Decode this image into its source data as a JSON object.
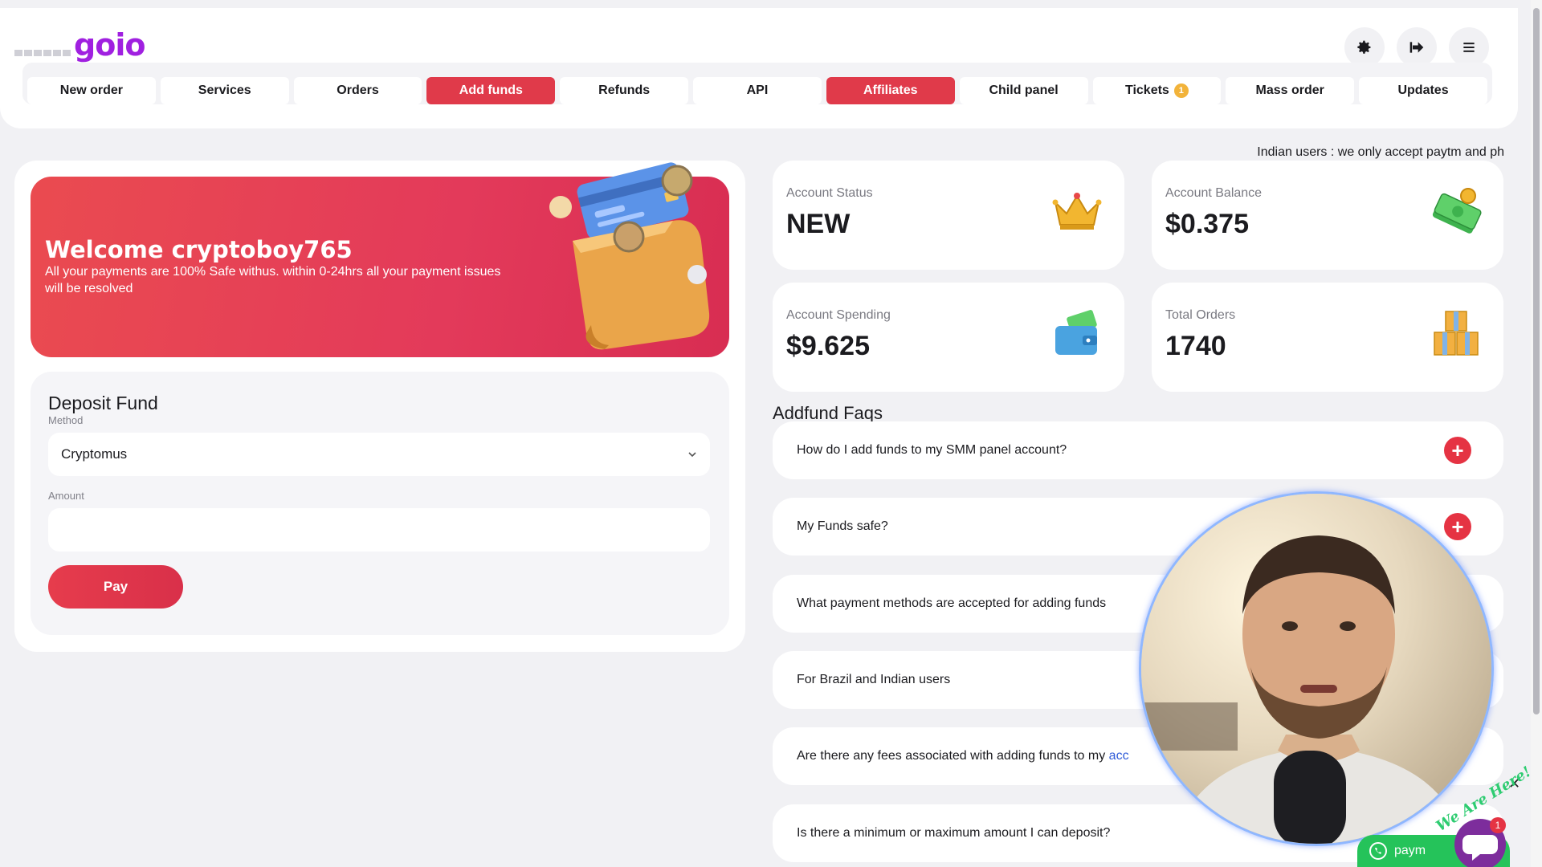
{
  "header": {
    "logo_text": "go",
    "logo_text_accent": "io",
    "icons": [
      "gear-icon",
      "logout-icon",
      "menu-icon"
    ]
  },
  "nav": {
    "tabs": [
      {
        "label": "New order",
        "active": false
      },
      {
        "label": "Services",
        "active": false
      },
      {
        "label": "Orders",
        "active": false
      },
      {
        "label": "Add funds",
        "active": true
      },
      {
        "label": "Refunds",
        "active": false
      },
      {
        "label": "API",
        "active": false
      },
      {
        "label": "Affiliates",
        "active": true
      },
      {
        "label": "Child panel",
        "active": false
      },
      {
        "label": "Tickets",
        "active": false,
        "badge": "1"
      },
      {
        "label": "Mass order",
        "active": false
      },
      {
        "label": "Updates",
        "active": false
      }
    ]
  },
  "ticker": "Indian users : we only accept paytm and ph",
  "hero": {
    "title": "Welcome cryptoboy765",
    "subtitle": "All your payments are 100% Safe withus. within 0-24hrs all your payment issues will be resolved"
  },
  "deposit": {
    "title": "Deposit Fund",
    "method_label": "Method",
    "method_value": "Cryptomus",
    "amount_label": "Amount",
    "amount_value": "",
    "pay_label": "Pay"
  },
  "stats": {
    "status": {
      "label": "Account Status",
      "value": "NEW",
      "icon": "crown-icon"
    },
    "balance": {
      "label": "Account Balance",
      "value": "$0.375",
      "icon": "money-icon"
    },
    "spending": {
      "label": "Account Spending",
      "value": "$9.625",
      "icon": "wallet-icon"
    },
    "orders": {
      "label": "Total Orders",
      "value": "1740",
      "icon": "boxes-icon"
    }
  },
  "faq": {
    "title": "Addfund Faqs",
    "items": [
      {
        "q": "How do I add funds to my SMM panel account?",
        "tail": ""
      },
      {
        "q": "My Funds safe?",
        "tail": ""
      },
      {
        "q": "What payment methods are accepted for adding funds",
        "tail": ""
      },
      {
        "q": "For Brazil and Indian users",
        "tail": ""
      },
      {
        "q": "Are there any fees associated with adding funds to my ",
        "tail": "acc"
      },
      {
        "q": "Is there a minimum or maximum amount I can deposit?",
        "tail": ""
      }
    ]
  },
  "widgets": {
    "whatsapp_label": "paym",
    "chat_badge": "1",
    "we_are_here": "We Are Here!",
    "close": "✕"
  },
  "colors": {
    "accent": "#e03a4a",
    "brand": "#a020e0",
    "background": "#f1f1f4"
  }
}
